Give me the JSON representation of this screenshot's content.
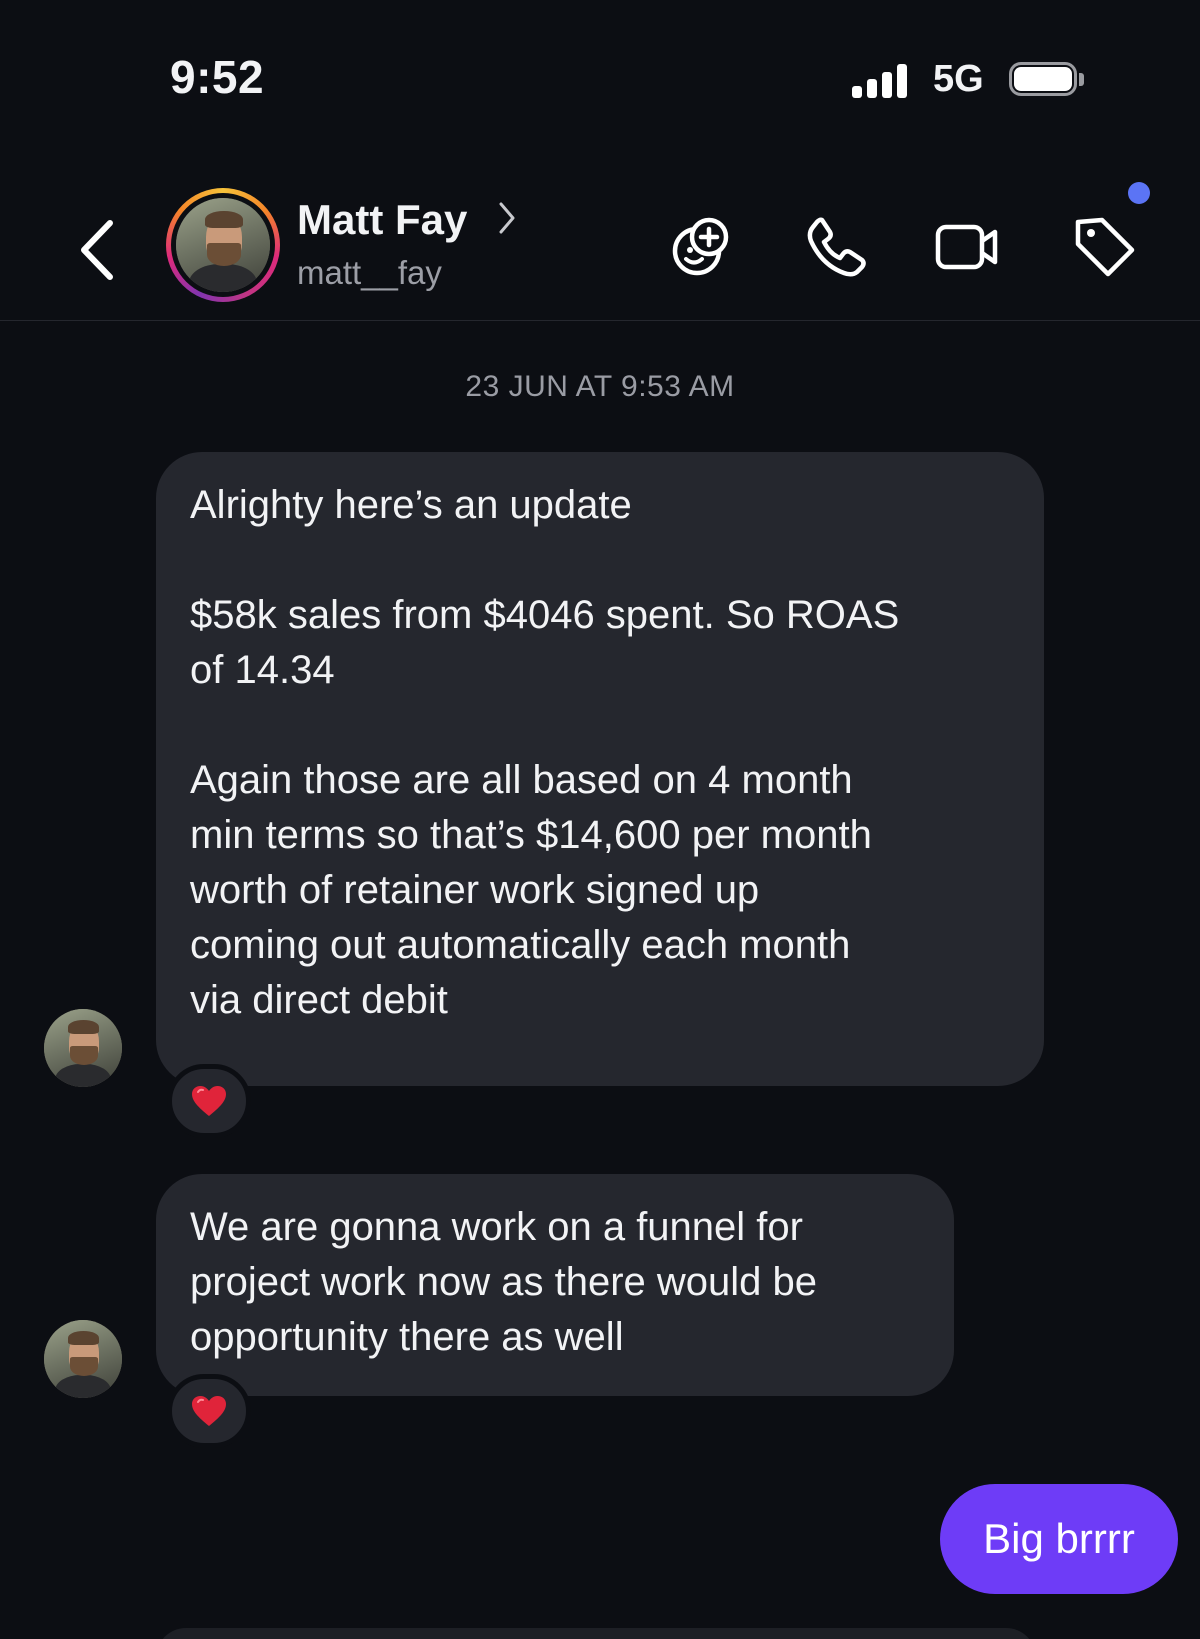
{
  "status_bar": {
    "time": "9:52",
    "network": "5G",
    "battery_level": 1.0
  },
  "header": {
    "back_icon": "chevron-left-icon",
    "contact_name": "Matt Fay",
    "username": "matt__fay",
    "actions": [
      {
        "icon": "sticker-add-icon"
      },
      {
        "icon": "phone-icon"
      },
      {
        "icon": "video-camera-icon"
      },
      {
        "icon": "tag-icon",
        "notification_dot": true
      }
    ],
    "accent_dot_color": "#5b74f5"
  },
  "thread": {
    "timestamp": "23 JUN AT 9:53 AM",
    "messages": [
      {
        "sender": "contact",
        "paragraphs": [
          "Alrighty here’s an update",
          "$58k sales from $4046 spent. So ROAS\nof 14.34",
          "Again those are all based on 4 month\nmin terms so that’s $14,600 per month\nworth of retainer work signed up\ncoming out automatically each month\nvia direct debit"
        ],
        "reaction": "heart"
      },
      {
        "sender": "contact",
        "paragraphs": [
          "We are gonna work on a funnel for\nproject work now as there would be\nopportunity there as well"
        ],
        "reaction": "heart"
      },
      {
        "sender": "me",
        "text": "Big brrrr"
      }
    ]
  },
  "colors": {
    "background": "#0c0e13",
    "incoming_bubble": "#25272e",
    "outgoing_bubble": "#6e3cf7",
    "reaction_heart": "#e0243a"
  }
}
